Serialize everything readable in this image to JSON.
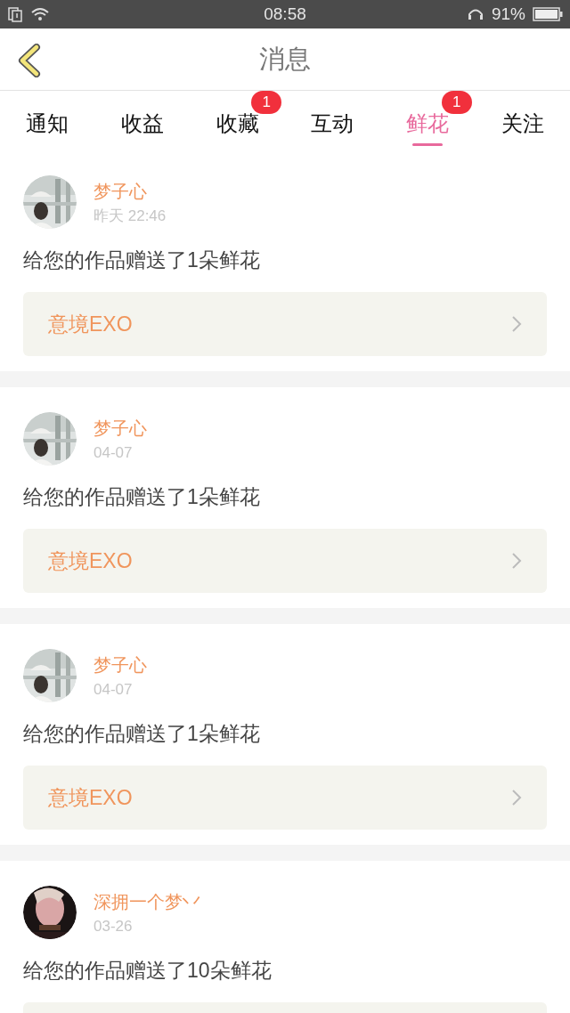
{
  "status_bar": {
    "time": "08:58",
    "battery": "91%"
  },
  "header": {
    "title": "消息"
  },
  "tabs": [
    {
      "label": "通知",
      "selected": false
    },
    {
      "label": "收益",
      "selected": false
    },
    {
      "label": "收藏",
      "selected": false,
      "badge": "1"
    },
    {
      "label": "互动",
      "selected": false
    },
    {
      "label": "鲜花",
      "selected": true,
      "badge": "1"
    },
    {
      "label": "关注",
      "selected": false
    }
  ],
  "messages": [
    {
      "name": "梦子心",
      "time": "昨天 22:46",
      "text": "给您的作品赠送了1朵鲜花",
      "link": "意境EXO"
    },
    {
      "name": "梦子心",
      "time": "04-07",
      "text": "给您的作品赠送了1朵鲜花",
      "link": "意境EXO"
    },
    {
      "name": "梦子心",
      "time": "04-07",
      "text": "给您的作品赠送了1朵鲜花",
      "link": "意境EXO"
    },
    {
      "name": "深拥一个梦丷",
      "time": "03-26",
      "text": "给您的作品赠送了10朵鲜花"
    }
  ]
}
